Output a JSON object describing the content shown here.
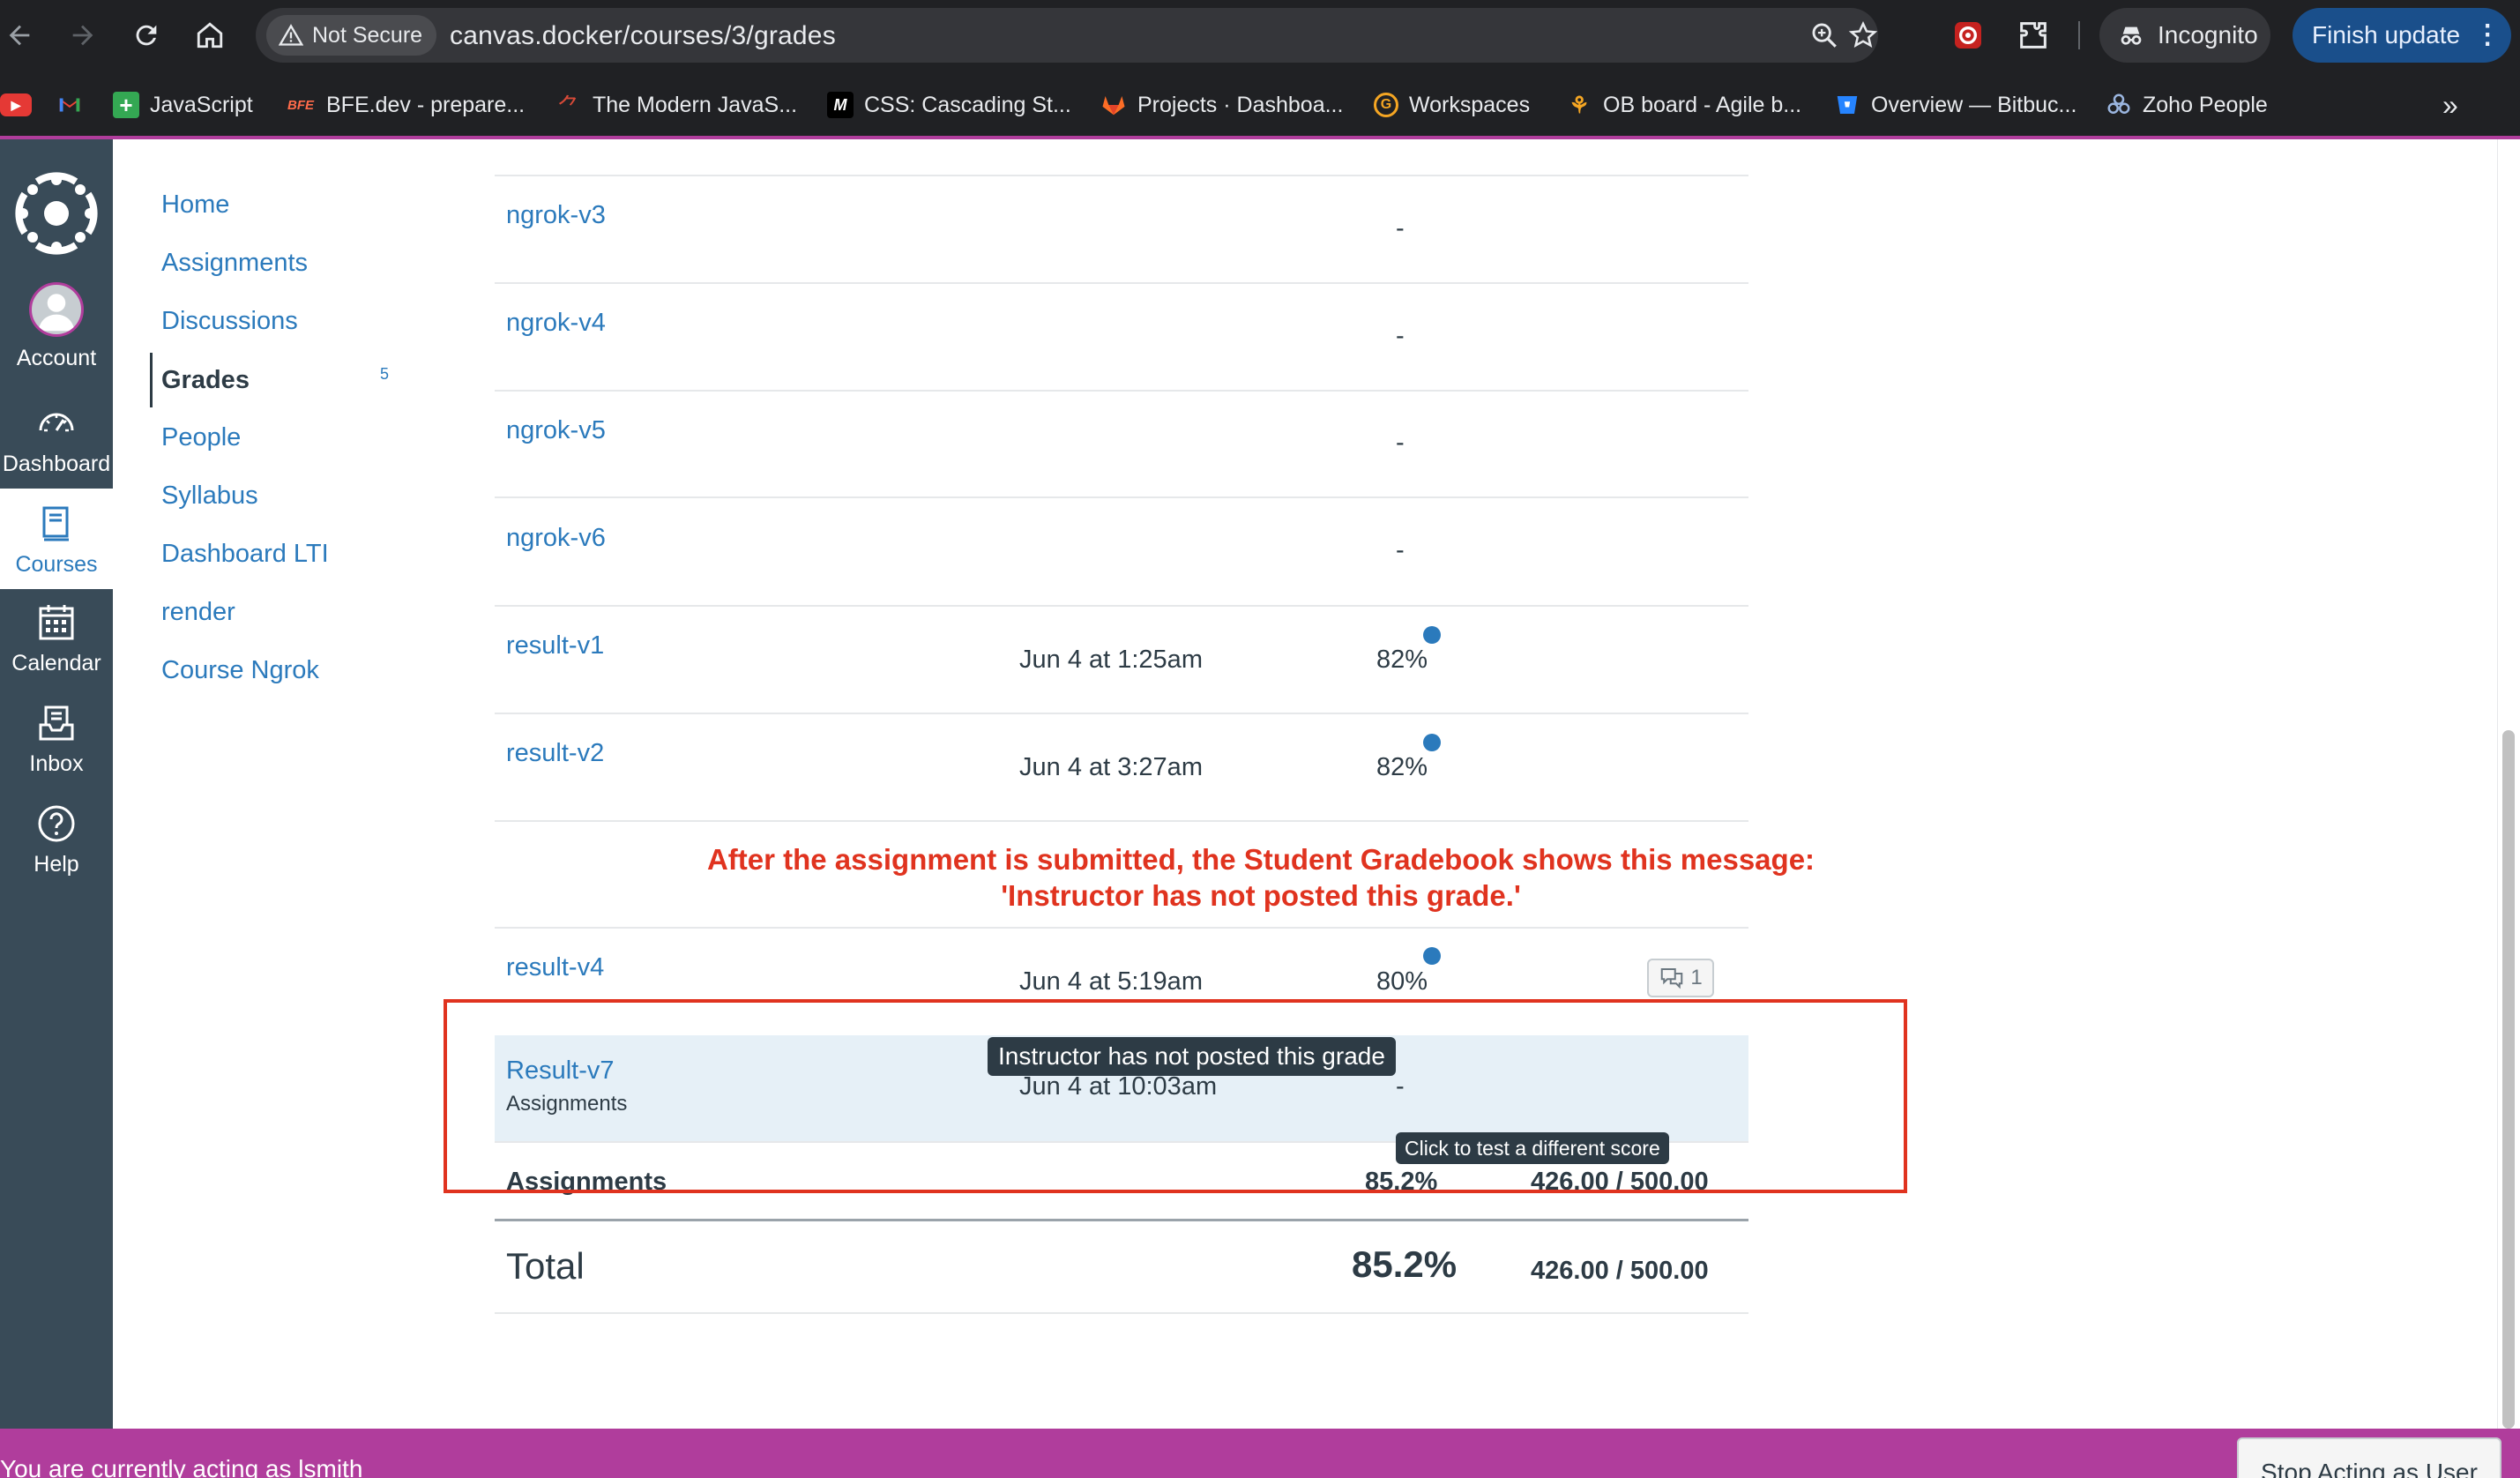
{
  "browser": {
    "security_label": "Not Secure",
    "url": "canvas.docker/courses/3/grades",
    "incognito_label": "Incognito",
    "update_label": "Finish update",
    "bookmarks": [
      {
        "label": "",
        "icon": "youtube-icon"
      },
      {
        "label": "",
        "icon": "gmail-icon"
      },
      {
        "label": "JavaScript",
        "icon": "plus-icon"
      },
      {
        "label": "BFE.dev - prepare...",
        "icon": "bfe-icon"
      },
      {
        "label": "The Modern JavaS...",
        "icon": "modern-js-icon"
      },
      {
        "label": "CSS: Cascading St...",
        "icon": "mdn-icon"
      },
      {
        "label": "Projects · Dashboa...",
        "icon": "gitlab-icon"
      },
      {
        "label": "Workspaces",
        "icon": "workspaces-icon"
      },
      {
        "label": "OB board - Agile b...",
        "icon": "jira-icon"
      },
      {
        "label": "Overview — Bitbuc...",
        "icon": "bitbucket-icon"
      },
      {
        "label": "Zoho People",
        "icon": "zoho-icon"
      }
    ],
    "overflow_label": "»"
  },
  "global_nav": {
    "items": [
      {
        "label": "Account",
        "icon": "avatar-icon"
      },
      {
        "label": "Dashboard",
        "icon": "dashboard-icon"
      },
      {
        "label": "Courses",
        "icon": "courses-icon",
        "active": true
      },
      {
        "label": "Calendar",
        "icon": "calendar-icon"
      },
      {
        "label": "Inbox",
        "icon": "inbox-icon"
      },
      {
        "label": "Help",
        "icon": "help-icon"
      }
    ]
  },
  "course_nav": {
    "items": [
      {
        "label": "Home"
      },
      {
        "label": "Assignments"
      },
      {
        "label": "Discussions"
      },
      {
        "label": "Grades",
        "active": true,
        "badge": "5"
      },
      {
        "label": "People"
      },
      {
        "label": "Syllabus"
      },
      {
        "label": "Dashboard LTI"
      },
      {
        "label": "render"
      },
      {
        "label": "Course Ngrok"
      }
    ]
  },
  "grades": {
    "rows": [
      {
        "name": "ngrok-v3",
        "due": "",
        "score": "-"
      },
      {
        "name": "ngrok-v4",
        "due": "",
        "score": "-"
      },
      {
        "name": "ngrok-v5",
        "due": "",
        "score": "-"
      },
      {
        "name": "ngrok-v6",
        "due": "",
        "score": "-"
      },
      {
        "name": "result-v1",
        "due": "Jun 4 at 1:25am",
        "score": "82%"
      },
      {
        "name": "result-v2",
        "due": "Jun 4 at 3:27am",
        "score": "82%"
      },
      {
        "name": "result-v4",
        "due": "Jun 4 at 5:19am",
        "score": "80%",
        "comments": "1"
      },
      {
        "name": "Result-v7",
        "group": "Assignments",
        "due": "Jun 4 at 10:03am",
        "score": "-"
      }
    ],
    "annotation_line1": "After the assignment is submitted, the Student Gradebook shows this message:",
    "annotation_line2": "'Instructor has not posted this grade.'",
    "tooltip_unposted": "Instructor has not posted this grade",
    "tooltip_what_if": "Click to test a different score",
    "group_total": {
      "label": "Assignments",
      "percent": "85.2%",
      "points": "426.00 / 500.00"
    },
    "total": {
      "label": "Total",
      "percent": "85.2%",
      "points": "426.00 / 500.00"
    }
  },
  "masquerade": {
    "text": "You are currently acting as lsmith",
    "stop_label": "Stop Acting as User"
  },
  "colors": {
    "canvas_nav": "#394b58",
    "link": "#2b7abc",
    "masquerade": "#b03d9c",
    "annotation": "#e0331f"
  }
}
